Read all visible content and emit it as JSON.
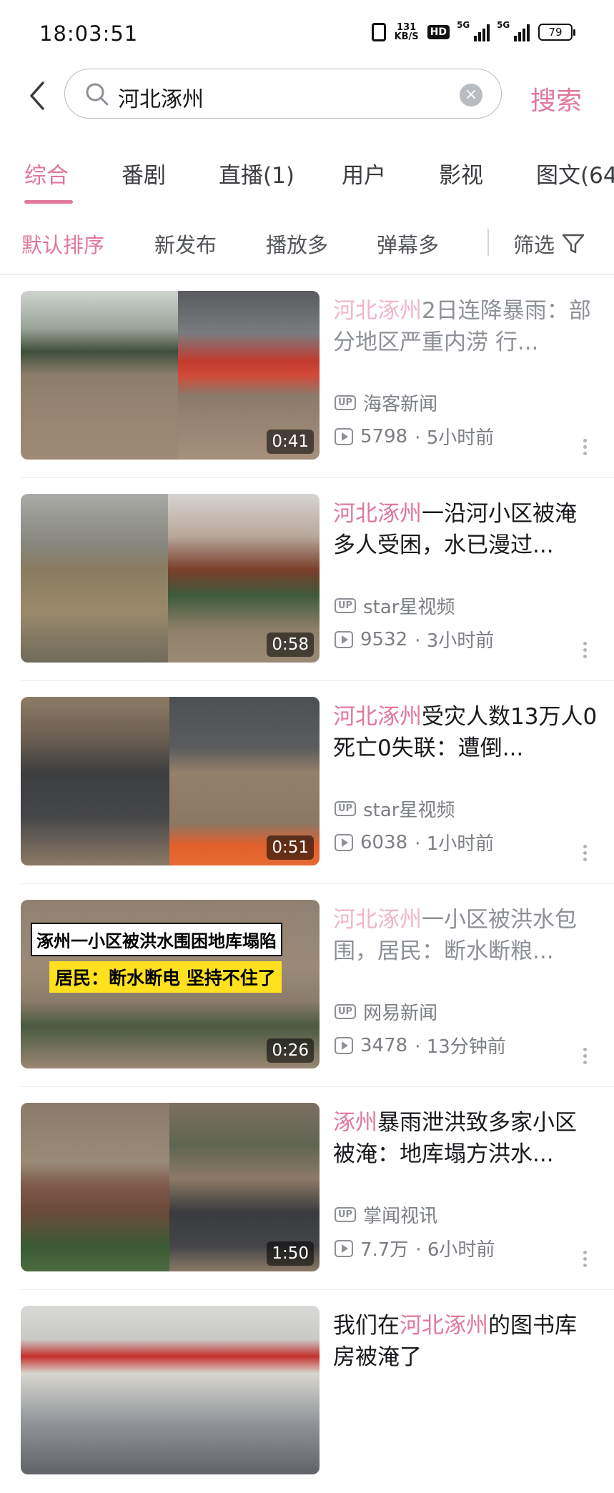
{
  "status_bar": {
    "time": "18:03:51",
    "net_speed": "131",
    "net_unit": "KB/S",
    "hd": "HD",
    "sig1": "5G",
    "sig2": "5G",
    "battery": "79"
  },
  "search": {
    "query": "河北涿州",
    "button": "搜索"
  },
  "tabs": [
    "综合",
    "番剧",
    "直播(1)",
    "用户",
    "影视",
    "图文(64"
  ],
  "active_tab": "综合",
  "sort": {
    "options": [
      "默认排序",
      "新发布",
      "播放多",
      "弹幕多"
    ],
    "filter": "筛选"
  },
  "colors": {
    "accent": "#e0799a",
    "muted": "#7b7e83"
  },
  "results": [
    {
      "title_hl": "河北涿州",
      "title_rest": "2日连降暴雨：部分地区严重内涝 行...",
      "uploader": "海客新闻",
      "views": "5798",
      "time": "· 5小时前",
      "duration": "0:41"
    },
    {
      "title_hl": "河北涿州",
      "title_rest": "一沿河小区被淹多人受困，水已漫过...",
      "uploader": "star星视频",
      "views": "9532",
      "time": "· 3小时前",
      "duration": "0:58"
    },
    {
      "title_hl": "河北涿州",
      "title_rest": "受灾人数13万人0死亡0失联：遭倒...",
      "uploader": "star星视频",
      "views": "6038",
      "time": "· 1小时前",
      "duration": "0:51"
    },
    {
      "title_hl": "河北涿州",
      "title_rest": "一小区被洪水包围，居民：断水断粮...",
      "uploader": "网易新闻",
      "views": "3478",
      "time": "· 13分钟前",
      "duration": "0:26",
      "caption1": "涿州一小区被洪水围困地库塌陷",
      "caption2": "居民：断水断电 坚持不住了"
    },
    {
      "title_hl": "涿州",
      "title_rest": "暴雨泄洪致多家小区被淹：地库塌方洪水...",
      "uploader": "掌闻视讯",
      "views": "7.7万",
      "time": "· 6小时前",
      "duration": "1:50"
    },
    {
      "title_pre": "我们在",
      "title_hl": "河北涿州",
      "title_rest": "的图书库房被淹了"
    }
  ]
}
